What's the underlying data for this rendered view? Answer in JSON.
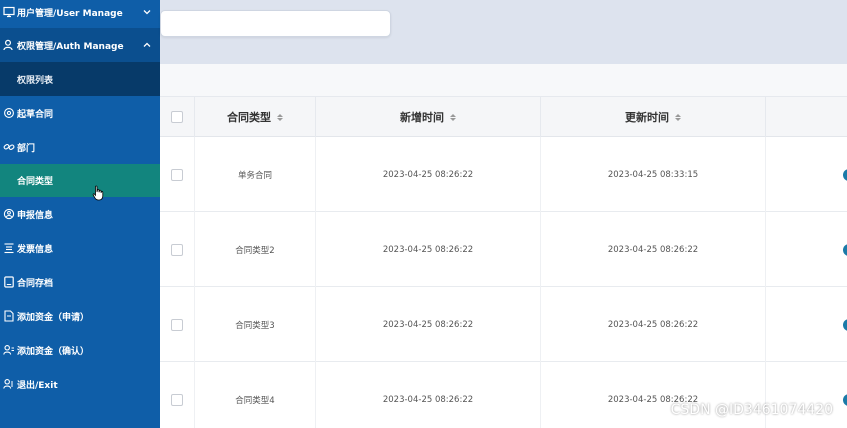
{
  "sidebar": {
    "items": [
      {
        "label": "用户管理/User Manage",
        "icon": "monitor-icon"
      },
      {
        "label": "权限管理/Auth Manage",
        "icon": "user-icon"
      },
      {
        "label": "权限列表",
        "icon": ""
      },
      {
        "label": "起草合同",
        "icon": "settings-icon"
      },
      {
        "label": "部门",
        "icon": "link-icon"
      },
      {
        "label": "合同类型",
        "icon": ""
      },
      {
        "label": "申报信息",
        "icon": "badge-icon"
      },
      {
        "label": "发票信息",
        "icon": "list-icon"
      },
      {
        "label": "合同存档",
        "icon": "document-icon"
      },
      {
        "label": "添加资金（申请）",
        "icon": "file-icon"
      },
      {
        "label": "添加资金（确认）",
        "icon": "users-icon"
      },
      {
        "label": "退出/Exit",
        "icon": "exit-icon"
      }
    ]
  },
  "search": {
    "placeholder": ""
  },
  "table": {
    "columns": [
      "合同类型",
      "新增时间",
      "更新时间"
    ],
    "rows": [
      {
        "type": "单务合同",
        "created": "2023-04-25 08:26:22",
        "updated": "2023-04-25 08:33:15"
      },
      {
        "type": "合同类型2",
        "created": "2023-04-25 08:26:22",
        "updated": "2023-04-25 08:26:22"
      },
      {
        "type": "合同类型3",
        "created": "2023-04-25 08:26:22",
        "updated": "2023-04-25 08:26:22"
      },
      {
        "type": "合同类型4",
        "created": "2023-04-25 08:26:22",
        "updated": "2023-04-25 08:26:22"
      }
    ]
  },
  "watermark": "CSDN @ID3461074420",
  "colors": {
    "sidebar": "#0f5ea8",
    "sidebar_submenu": "#073a69",
    "active": "#12857e",
    "topbar": "#dde3ee",
    "accent_dot": "#1b7aa8"
  }
}
